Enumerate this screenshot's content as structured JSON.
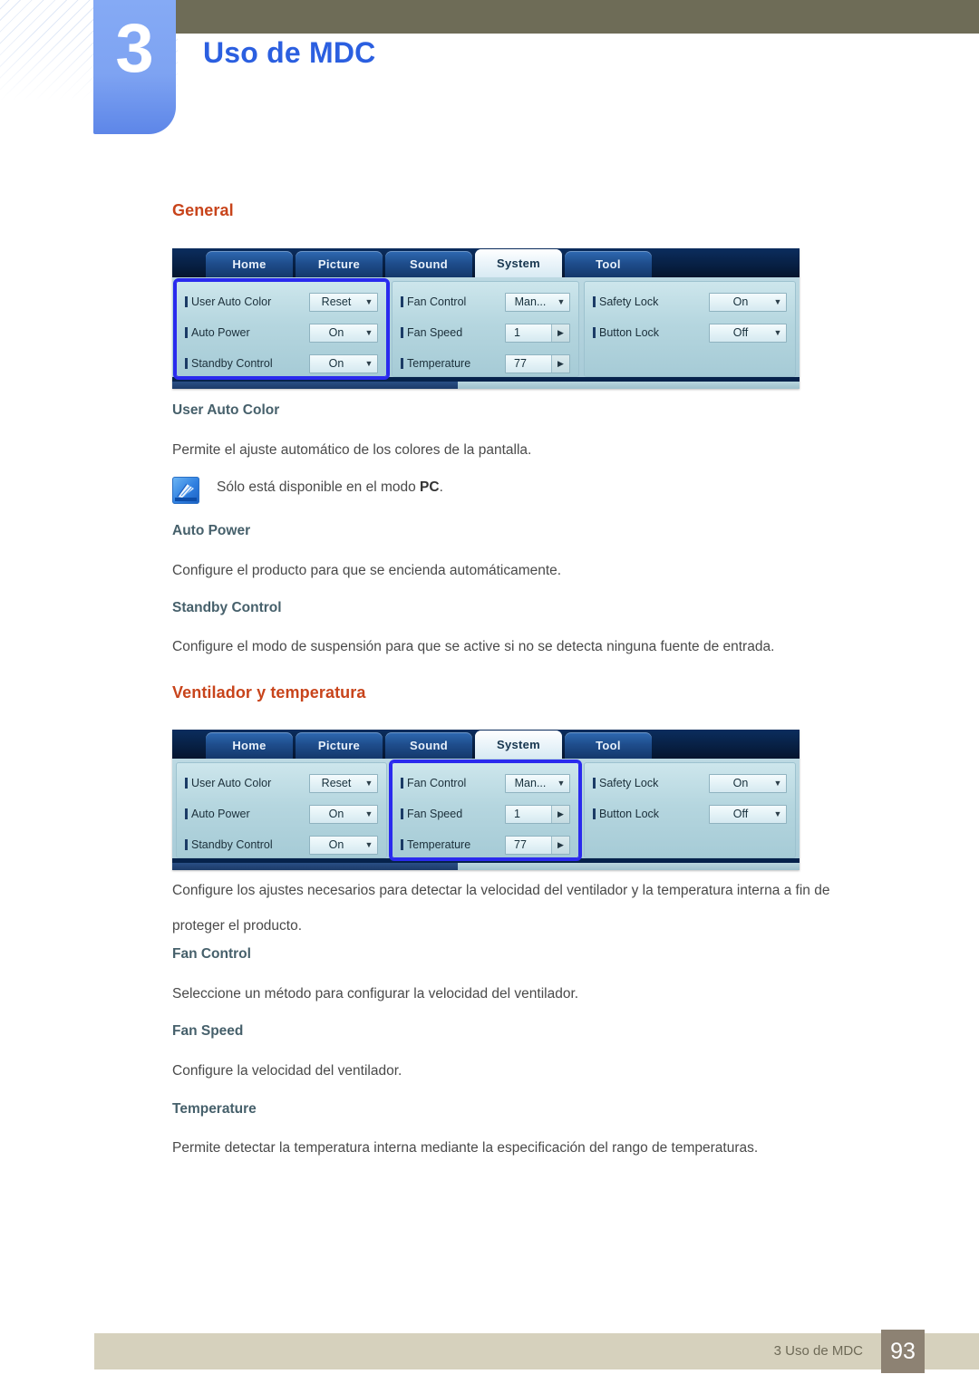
{
  "header": {
    "chapter_number": "3",
    "chapter_title": "Uso de MDC"
  },
  "sections": {
    "general_heading": "General",
    "fan_heading": "Ventilador y temperatura"
  },
  "general": {
    "sub1": "User Auto Color",
    "para1": "Permite el ajuste automático de los colores de la pantalla.",
    "note_prefix": "Sólo está disponible en el modo ",
    "note_bold": "PC",
    "note_suffix": ".",
    "sub2": "Auto Power",
    "para2": "Configure el producto para que se encienda automáticamente.",
    "sub3": "Standby Control",
    "para3": "Configure el modo de suspensión para que se active si no se detecta ninguna fuente de entrada."
  },
  "fan": {
    "para_intro_line1": "Configure los ajustes necesarios para detectar la velocidad del ventilador y la temperatura interna a fin de",
    "para_intro_line2": "proteger el producto.",
    "sub1": "Fan Control",
    "para1": "Seleccione un método para configurar la velocidad del ventilador.",
    "sub2": "Fan Speed",
    "para2": "Configure la velocidad del ventilador.",
    "sub3": "Temperature",
    "para3": "Permite detectar la temperatura interna mediante la especificación del rango de temperaturas."
  },
  "mdc": {
    "tabs": [
      {
        "label": "Home",
        "active": false
      },
      {
        "label": "Picture",
        "active": false
      },
      {
        "label": "Sound",
        "active": false
      },
      {
        "label": "System",
        "active": true
      },
      {
        "label": "Tool",
        "active": false
      }
    ],
    "col1": {
      "rows": [
        {
          "label": "User Auto Color",
          "value": "Reset",
          "control": "dropdown"
        },
        {
          "label": "Auto Power",
          "value": "On",
          "control": "dropdown"
        },
        {
          "label": "Standby Control",
          "value": "On",
          "control": "dropdown"
        }
      ]
    },
    "col2": {
      "rows": [
        {
          "label": "Fan Control",
          "value": "Man...",
          "control": "dropdown"
        },
        {
          "label": "Fan Speed",
          "value": "1",
          "control": "spinner"
        },
        {
          "label": "Temperature",
          "value": "77",
          "control": "spinner"
        }
      ]
    },
    "col3": {
      "rows": [
        {
          "label": "Safety Lock",
          "value": "On",
          "control": "dropdown"
        },
        {
          "label": "Button Lock",
          "value": "Off",
          "control": "dropdown"
        }
      ]
    },
    "selected_column_screenshot1": "col1",
    "selected_column_screenshot2": "col2"
  },
  "footer": {
    "text": "3 Uso de MDC",
    "page": "93"
  },
  "colors": {
    "chapter_title": "#2b5fe0",
    "section_heading": "#c8441b",
    "sub_heading": "#46606b",
    "body_text": "#4a4a4a",
    "olive_band": "#6e6c57",
    "footer_bar": "#d6d1bd",
    "footer_page_box": "#8d8273",
    "mdc_highlight": "#2a2aee"
  }
}
